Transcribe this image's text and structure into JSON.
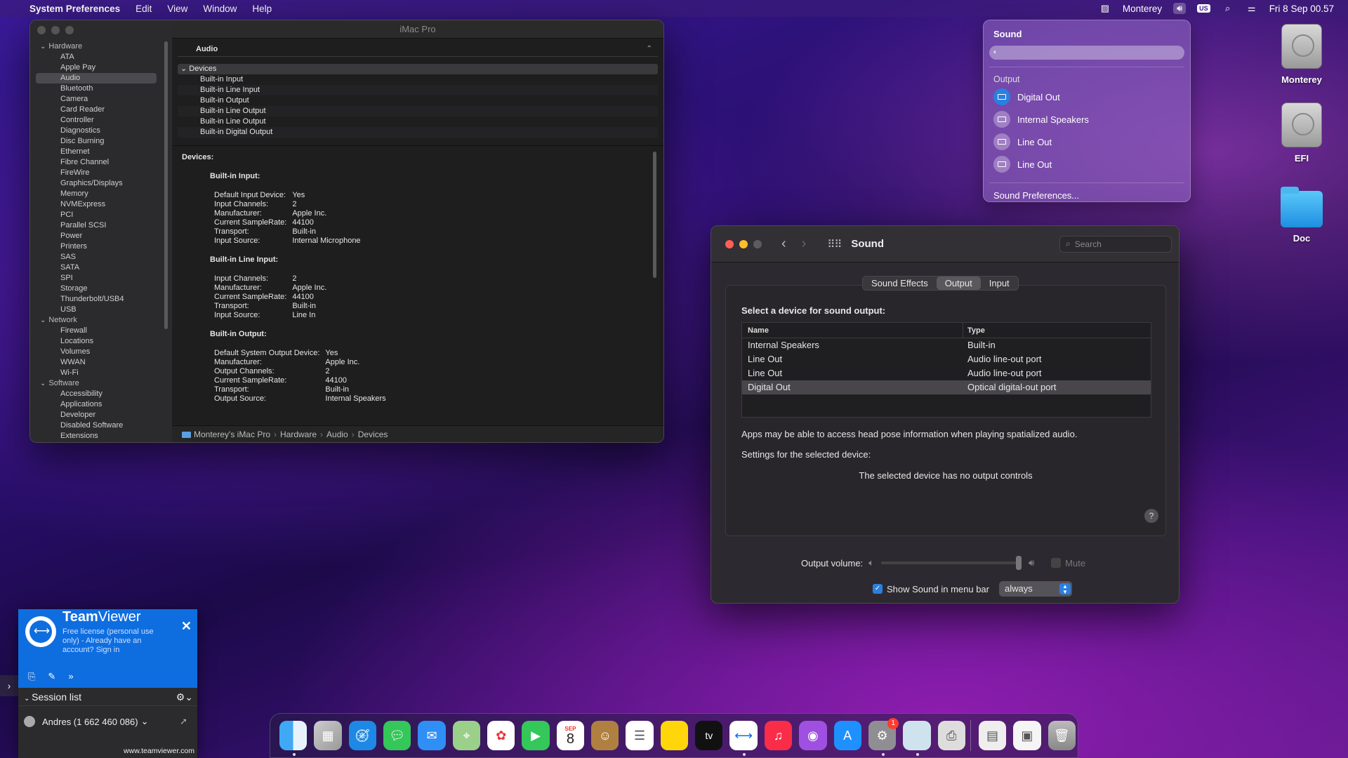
{
  "menubar": {
    "app_name": "System Preferences",
    "menus": [
      "Edit",
      "View",
      "Window",
      "Help"
    ],
    "right": {
      "user": "Monterey",
      "input_source": "US",
      "datetime": "Fri 8 Sep  00.57"
    }
  },
  "sysinfo": {
    "window_title": "iMac Pro",
    "sidebar": {
      "groups": [
        {
          "label": "Hardware",
          "items": [
            "ATA",
            "Apple Pay",
            "Audio",
            "Bluetooth",
            "Camera",
            "Card Reader",
            "Controller",
            "Diagnostics",
            "Disc Burning",
            "Ethernet",
            "Fibre Channel",
            "FireWire",
            "Graphics/Displays",
            "Memory",
            "NVMExpress",
            "PCI",
            "Parallel SCSI",
            "Power",
            "Printers",
            "SAS",
            "SATA",
            "SPI",
            "Storage",
            "Thunderbolt/USB4",
            "USB"
          ]
        },
        {
          "label": "Network",
          "items": [
            "Firewall",
            "Locations",
            "Volumes",
            "WWAN",
            "Wi-Fi"
          ]
        },
        {
          "label": "Software",
          "items": [
            "Accessibility",
            "Applications",
            "Developer",
            "Disabled Software",
            "Extensions"
          ]
        }
      ],
      "selected": "Audio"
    },
    "section_header": "Audio",
    "device_list_header": "Devices",
    "devices": [
      "Built-in Input",
      "Built-in Line Input",
      "Built-in Output",
      "Built-in Line Output",
      "Built-in Line Output",
      "Built-in Digital Output"
    ],
    "detail_title": "Devices:",
    "details": [
      {
        "name": "Built-in Input:",
        "props": [
          [
            "Default Input Device:",
            "Yes"
          ],
          [
            "Input Channels:",
            "2"
          ],
          [
            "Manufacturer:",
            "Apple Inc."
          ],
          [
            "Current SampleRate:",
            "44100"
          ],
          [
            "Transport:",
            "Built-in"
          ],
          [
            "Input Source:",
            "Internal Microphone"
          ]
        ]
      },
      {
        "name": "Built-in Line Input:",
        "props": [
          [
            "Input Channels:",
            "2"
          ],
          [
            "Manufacturer:",
            "Apple Inc."
          ],
          [
            "Current SampleRate:",
            "44100"
          ],
          [
            "Transport:",
            "Built-in"
          ],
          [
            "Input Source:",
            "Line In"
          ]
        ]
      },
      {
        "name": "Built-in Output:",
        "props": [
          [
            "Default System Output Device:",
            "Yes"
          ],
          [
            "Manufacturer:",
            "Apple Inc."
          ],
          [
            "Output Channels:",
            "2"
          ],
          [
            "Current SampleRate:",
            "44100"
          ],
          [
            "Transport:",
            "Built-in"
          ],
          [
            "Output Source:",
            "Internal Speakers"
          ]
        ]
      }
    ],
    "path": [
      "Monterey's iMac Pro",
      "Hardware",
      "Audio",
      "Devices"
    ]
  },
  "sound_menu": {
    "title": "Sound",
    "output_label": "Output",
    "devices": [
      {
        "label": "Digital Out",
        "active": true
      },
      {
        "label": "Internal Speakers",
        "active": false
      },
      {
        "label": "Line Out",
        "active": false
      },
      {
        "label": "Line Out",
        "active": false
      }
    ],
    "prefs_link": "Sound Preferences..."
  },
  "sound_prefs": {
    "title": "Sound",
    "search_placeholder": "Search",
    "tabs": [
      "Sound Effects",
      "Output",
      "Input"
    ],
    "active_tab": "Output",
    "select_label": "Select a device for sound output:",
    "columns": [
      "Name",
      "Type"
    ],
    "rows": [
      {
        "name": "Internal Speakers",
        "type": "Built-in",
        "selected": false
      },
      {
        "name": "Line Out",
        "type": "Audio line-out port",
        "selected": false
      },
      {
        "name": "Line Out",
        "type": "Audio line-out port",
        "selected": false
      },
      {
        "name": "Digital Out",
        "type": "Optical digital-out port",
        "selected": true
      }
    ],
    "head_pose_note": "Apps may be able to access head pose information when playing spatialized audio.",
    "settings_label": "Settings for the selected device:",
    "no_controls": "The selected device has no output controls",
    "help": "?",
    "output_volume_label": "Output volume:",
    "output_volume_level": 1.0,
    "mute_label": "Mute",
    "show_in_menubar_label": "Show Sound in menu bar",
    "show_in_menubar_checked": true,
    "menubar_option": "always"
  },
  "desktop": {
    "icons": [
      "Monterey",
      "EFI",
      "Doc"
    ]
  },
  "teamviewer": {
    "brand_bold": "Team",
    "brand_rest": "Viewer",
    "license": "Free license (personal use only) - Already have an account? Sign in",
    "session_list": "Session list",
    "user": "Andres (1 662 460 086)",
    "url": "www.teamviewer.com"
  },
  "dock": {
    "calendar_month": "SEP",
    "calendar_day": "8",
    "tv_label": "tv",
    "settings_badge": "1"
  },
  "colors": {
    "accent": "#2b7fe0",
    "teamviewer": "#0e6ee0",
    "close_red": "#ff5f57",
    "min_yellow": "#febc2e"
  }
}
